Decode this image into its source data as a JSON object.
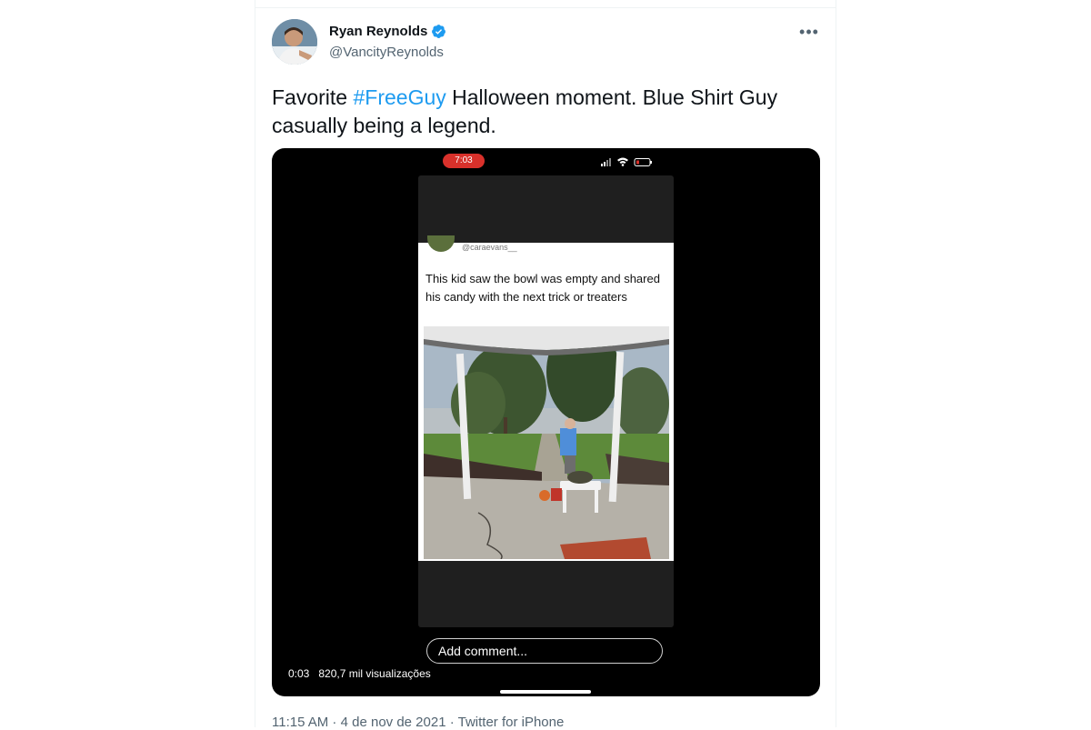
{
  "author": {
    "name": "Ryan Reynolds",
    "handle": "@VancityReynolds",
    "verified": true
  },
  "tweet": {
    "text_before": "Favorite ",
    "hashtag": "#FreeGuy",
    "text_after": " Halloween moment. Blue Shirt Guy casually being a legend."
  },
  "video": {
    "phone_time": "7:03",
    "inner_tweet": {
      "handle": "@caraevans__",
      "text": "This kid saw the bowl was empty and shared his candy with the next trick or treaters"
    },
    "comment_placeholder": "Add comment...",
    "timestamp": "0:03",
    "views": "820,7 mil visualizações"
  },
  "footer": {
    "time": "11:15 AM",
    "separator": " · ",
    "date": "4 de nov de 2021",
    "source": "Twitter for iPhone"
  },
  "colors": {
    "accent": "#1d9bf0",
    "text": "#0f1419",
    "muted": "#536471",
    "recording_pill": "#d9312b"
  },
  "icons": [
    "verified-badge-icon",
    "more-options-icon",
    "signal-icon",
    "wifi-icon",
    "battery-icon"
  ]
}
